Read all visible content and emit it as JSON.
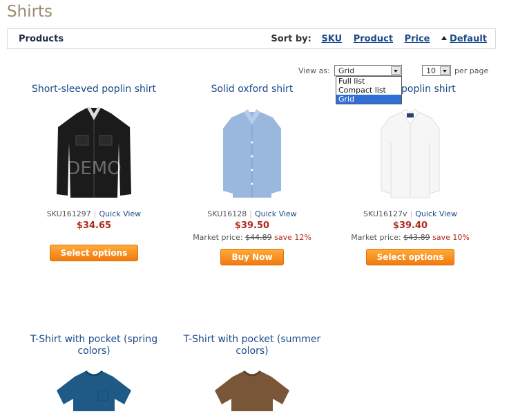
{
  "page": {
    "title": "Shirts"
  },
  "bar": {
    "products_label": "Products",
    "sort_label": "Sort by:",
    "sort_options": [
      "SKU",
      "Product",
      "Price",
      "Default"
    ],
    "sort_active": "Default"
  },
  "view_as": {
    "label": "View as:",
    "value": "Grid",
    "options": [
      "Full list",
      "Compact list",
      "Grid"
    ],
    "selected": "Grid"
  },
  "per_page": {
    "value": "10",
    "label": "per page"
  },
  "products": [
    {
      "name": "Short-sleeved poplin shirt",
      "sku": "SKU161297",
      "quick_view": "Quick View",
      "price": "$34.65",
      "market_label": "",
      "market_price": "",
      "save": "",
      "button": "Select options",
      "watermark": "DEMO",
      "color": "#1b1b1b"
    },
    {
      "name": "Solid oxford shirt",
      "sku": "SKU16128",
      "quick_view": "Quick View",
      "price": "$39.50",
      "market_label": "Market price:",
      "market_price": "$44.89",
      "save": "save 12%",
      "button": "Buy Now",
      "color": "#8eaed8"
    },
    {
      "name": "poplin shirt",
      "sku": "SKU16127v",
      "quick_view": "Quick View",
      "price": "$39.40",
      "market_label": "Market price:",
      "market_price": "$43.89",
      "save": "save 10%",
      "button": "Select options",
      "color": "#f4f4f4"
    },
    {
      "name": "T-Shirt with pocket (spring colors)",
      "color": "#1f5a86"
    },
    {
      "name": "T-Shirt with pocket (summer colors)",
      "color": "#7a5638"
    }
  ]
}
